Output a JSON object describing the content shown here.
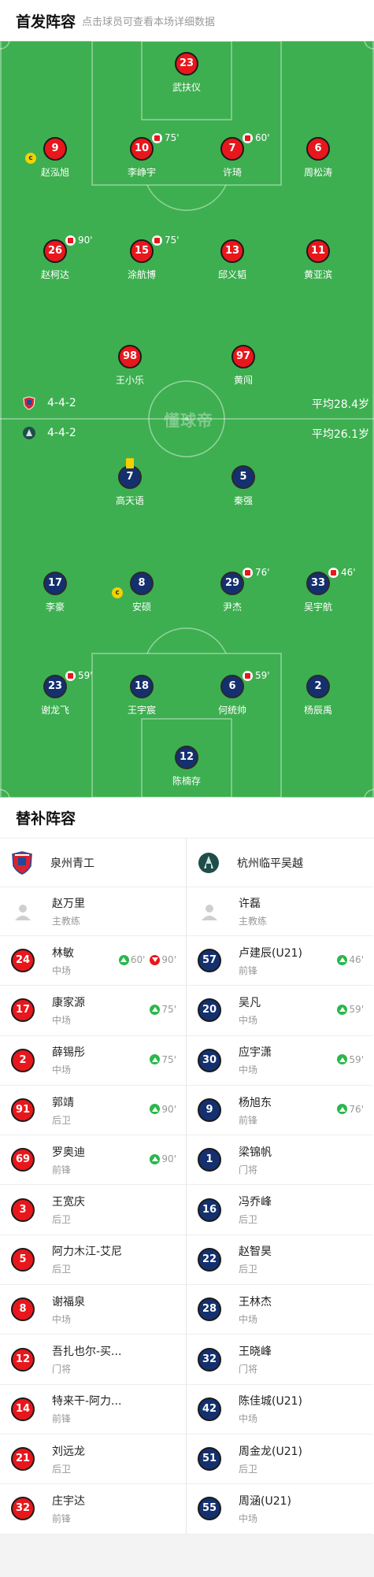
{
  "header": {
    "title": "首发阵容",
    "subtitle": "点击球员可查看本场详细数据"
  },
  "watermark": "懂球帝",
  "home_formation": "4-4-2",
  "home_avg_age": "平均28.4岁",
  "away_formation": "4-4-2",
  "away_avg_age": "平均26.1岁",
  "colors": {
    "pitch": "#3daf50",
    "home": "#e8171c",
    "away": "#14306e",
    "captain": "#f2d200",
    "sub_in": "#2ab74b",
    "sub_out": "#e8171c"
  },
  "home_players": [
    {
      "number": "23",
      "name": "武扶仪"
    },
    {
      "number": "9",
      "name": "赵泓旭",
      "captain": "c"
    },
    {
      "number": "10",
      "name": "李峥宇",
      "sub_out": "75'"
    },
    {
      "number": "7",
      "name": "许琦",
      "sub_out": "60'"
    },
    {
      "number": "6",
      "name": "周松涛"
    },
    {
      "number": "26",
      "name": "赵柯达",
      "sub_out": "90'"
    },
    {
      "number": "15",
      "name": "涂航博",
      "sub_out": "75'"
    },
    {
      "number": "13",
      "name": "邱义韬"
    },
    {
      "number": "11",
      "name": "黄亚滨"
    },
    {
      "number": "98",
      "name": "王小乐"
    },
    {
      "number": "97",
      "name": "黄闯"
    }
  ],
  "away_players": [
    {
      "number": "7",
      "name": "高天语",
      "yellow_card": true
    },
    {
      "number": "5",
      "name": "秦强"
    },
    {
      "number": "17",
      "name": "李豪"
    },
    {
      "number": "8",
      "name": "安硕",
      "captain": "c"
    },
    {
      "number": "29",
      "name": "尹杰",
      "sub_out": "76'"
    },
    {
      "number": "33",
      "name": "吴宇航",
      "sub_out": "46'"
    },
    {
      "number": "23",
      "name": "谢龙飞",
      "sub_out": "59'"
    },
    {
      "number": "18",
      "name": "王宇宸"
    },
    {
      "number": "6",
      "name": "何统帅",
      "sub_out": "59'"
    },
    {
      "number": "2",
      "name": "杨辰禹"
    },
    {
      "number": "12",
      "name": "陈楠存"
    }
  ],
  "subs_title": "替补阵容",
  "home_team": {
    "name": "泉州青工",
    "coach": {
      "name": "赵万里",
      "role": "主教练"
    },
    "subs": [
      {
        "number": "24",
        "name": "林敏",
        "pos": "中场",
        "in": "60'",
        "out": "90'"
      },
      {
        "number": "17",
        "name": "康家源",
        "pos": "中场",
        "in": "75'"
      },
      {
        "number": "2",
        "name": "薛锡彤",
        "pos": "中场",
        "in": "75'"
      },
      {
        "number": "91",
        "name": "郭靖",
        "pos": "后卫",
        "in": "90'"
      },
      {
        "number": "69",
        "name": "罗奥迪",
        "pos": "前锋",
        "in": "90'"
      },
      {
        "number": "3",
        "name": "王宽庆",
        "pos": "后卫"
      },
      {
        "number": "5",
        "name": "阿力木江-艾尼",
        "pos": "后卫"
      },
      {
        "number": "8",
        "name": "谢福泉",
        "pos": "中场"
      },
      {
        "number": "12",
        "name": "吾扎也尔-买...",
        "pos": "门将"
      },
      {
        "number": "14",
        "name": "特来干-阿力...",
        "pos": "前锋"
      },
      {
        "number": "21",
        "name": "刘远龙",
        "pos": "后卫"
      },
      {
        "number": "32",
        "name": "庄宇达",
        "pos": "前锋"
      }
    ]
  },
  "away_team": {
    "name": "杭州临平吴越",
    "coach": {
      "name": "许磊",
      "role": "主教练"
    },
    "subs": [
      {
        "number": "57",
        "name": "卢建辰(U21)",
        "pos": "前锋",
        "in": "46'"
      },
      {
        "number": "20",
        "name": "吴凡",
        "pos": "中场",
        "in": "59'"
      },
      {
        "number": "30",
        "name": "应宇潇",
        "pos": "中场",
        "in": "59'"
      },
      {
        "number": "9",
        "name": "杨旭东",
        "pos": "前锋",
        "in": "76'"
      },
      {
        "number": "1",
        "name": "梁锦帆",
        "pos": "门将"
      },
      {
        "number": "16",
        "name": "冯乔峰",
        "pos": "后卫"
      },
      {
        "number": "22",
        "name": "赵智昊",
        "pos": "后卫"
      },
      {
        "number": "28",
        "name": "王林杰",
        "pos": "中场"
      },
      {
        "number": "32",
        "name": "王晓峰",
        "pos": "门将"
      },
      {
        "number": "42",
        "name": "陈佳城(U21)",
        "pos": "中场"
      },
      {
        "number": "51",
        "name": "周金龙(U21)",
        "pos": "后卫"
      },
      {
        "number": "55",
        "name": "周涵(U21)",
        "pos": "中场"
      }
    ]
  }
}
